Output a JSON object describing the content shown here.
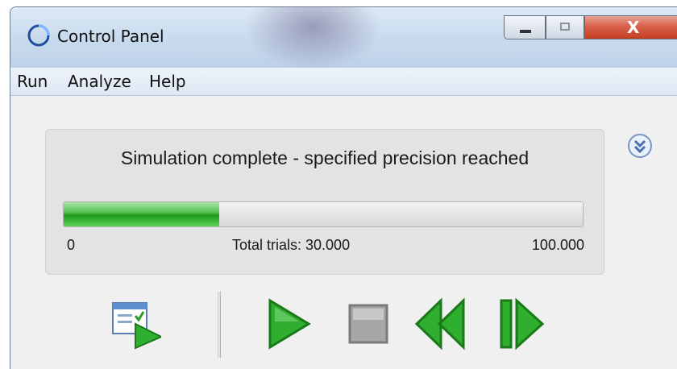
{
  "window": {
    "title": "Control Panel",
    "buttons": {
      "minimize": "minimize",
      "maximize": "maximize",
      "close": "close"
    }
  },
  "menu": {
    "items": [
      {
        "label": "Run"
      },
      {
        "label": "Analyze"
      },
      {
        "label": "Help"
      }
    ]
  },
  "status": {
    "message": "Simulation complete - specified precision reached",
    "progress_fraction": 0.3,
    "scale_min": "0",
    "scale_label": "Total trials: 30.000",
    "scale_max": "100.000"
  },
  "toolbar": {
    "buttons": [
      {
        "name": "run-report-button",
        "icon": "report-run-icon"
      },
      {
        "name": "start-button",
        "icon": "play-icon"
      },
      {
        "name": "stop-button",
        "icon": "stop-icon"
      },
      {
        "name": "reset-button",
        "icon": "rewind-icon"
      },
      {
        "name": "step-button",
        "icon": "step-forward-icon"
      }
    ]
  },
  "colors": {
    "progress_green": "#1c9b1a",
    "icon_green": "#2fae2f",
    "close_red": "#c43d22"
  }
}
